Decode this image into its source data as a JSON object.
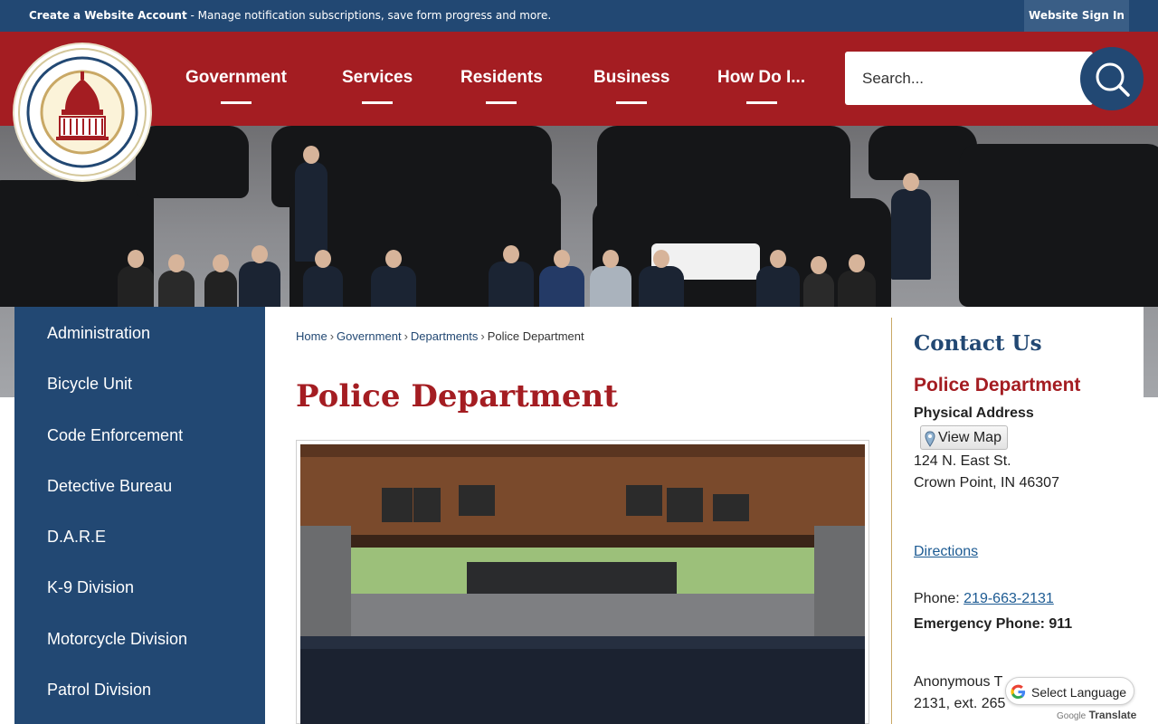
{
  "topbar": {
    "account_link": "Create a Website Account",
    "account_desc": " - Manage notification subscriptions, save form progress and more.",
    "signin": "Website Sign In"
  },
  "logo": {
    "top_text": "Hub of Lake County",
    "bottom_text": "CROWN POINT"
  },
  "nav": {
    "items": [
      {
        "label": "Government"
      },
      {
        "label": "Services"
      },
      {
        "label": "Residents"
      },
      {
        "label": "Business"
      },
      {
        "label": "How Do I..."
      }
    ]
  },
  "search": {
    "placeholder": "Search..."
  },
  "sidebar": {
    "items": [
      {
        "label": "Administration"
      },
      {
        "label": "Bicycle Unit"
      },
      {
        "label": "Code Enforcement"
      },
      {
        "label": "Detective Bureau"
      },
      {
        "label": "D.A.R.E"
      },
      {
        "label": "K-9 Division"
      },
      {
        "label": "Motorcycle Division"
      },
      {
        "label": "Patrol Division"
      }
    ]
  },
  "breadcrumb": {
    "items": [
      {
        "label": "Home"
      },
      {
        "label": "Government"
      },
      {
        "label": "Departments"
      }
    ],
    "current": "Police Department"
  },
  "page": {
    "title": "Police Department"
  },
  "contact": {
    "title": "Contact Us",
    "department": "Police Department",
    "address_label": "Physical Address",
    "map_button": "View Map",
    "address_line1": "124 N. East St.",
    "address_line2": "Crown Point, IN 46307",
    "directions": "Directions",
    "phone_label": "Phone: ",
    "phone": "219-663-2131",
    "emergency": "Emergency Phone: 911",
    "anon_line1": "Anonymous T",
    "anon_line2": "2131, ext. 265"
  },
  "translate": {
    "label": "Select Language",
    "powered_brand": "Google",
    "powered_word": "Translate"
  },
  "colors": {
    "navy": "#224873",
    "red": "#a41d22",
    "gold": "#c9a865"
  }
}
